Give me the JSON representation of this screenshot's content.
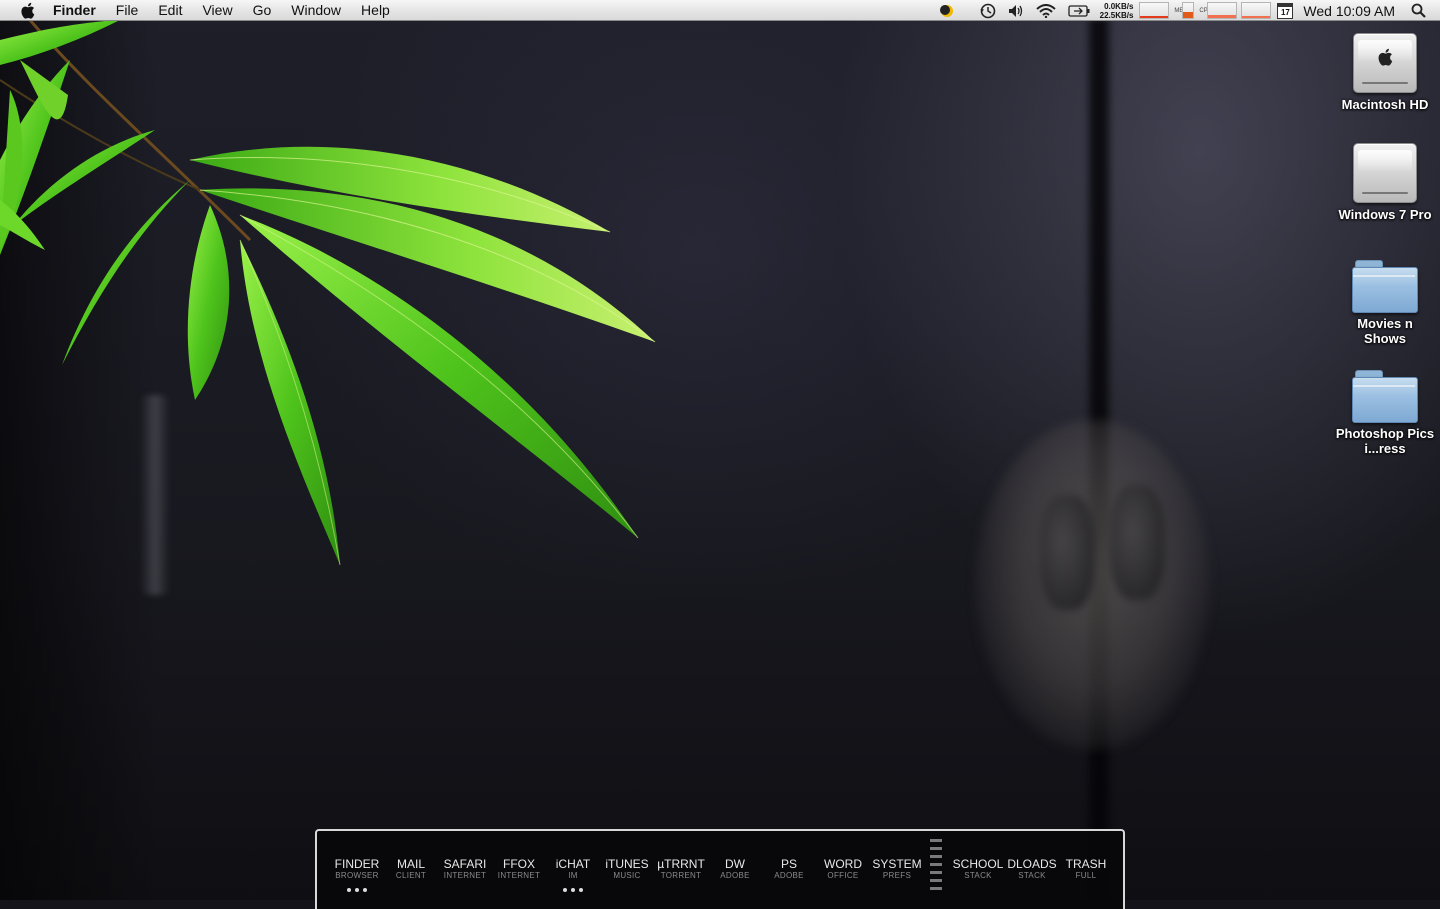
{
  "menubar": {
    "app_name": "Finder",
    "menus": [
      "File",
      "Edit",
      "View",
      "Go",
      "Window",
      "Help"
    ],
    "net_down": "0.0KB/s",
    "net_up": "22.5KB/s",
    "mem_label": "MEM",
    "cpu_label": "CPU",
    "calendar_day": "17",
    "clock": "Wed 10:09 AM",
    "status_icons": [
      "moon-icon",
      "time-machine-icon",
      "volume-icon",
      "wifi-icon",
      "battery-icon",
      "calendar-icon",
      "spotlight-icon"
    ]
  },
  "desktop_icons": [
    {
      "label": "Macintosh HD",
      "kind": "hard-drive-apple"
    },
    {
      "label": "Windows 7 Pro",
      "kind": "hard-drive"
    },
    {
      "label": "Movies n Shows",
      "kind": "folder"
    },
    {
      "label": "Photoshop Pics i...ress",
      "kind": "folder"
    }
  ],
  "dock": {
    "items": [
      {
        "name": "FINDER",
        "sub": "BROWSER",
        "running": true
      },
      {
        "name": "MAIL",
        "sub": "CLIENT",
        "running": false
      },
      {
        "name": "SAFARI",
        "sub": "INTERNET",
        "running": false
      },
      {
        "name": "FFOX",
        "sub": "INTERNET",
        "running": false
      },
      {
        "name": "iCHAT",
        "sub": "IM",
        "running": true
      },
      {
        "name": "iTUNES",
        "sub": "MUSIC",
        "running": false
      },
      {
        "name": "µTRRNT",
        "sub": "TORRENT",
        "running": false
      },
      {
        "name": "DW",
        "sub": "ADOBE",
        "running": false
      },
      {
        "name": "PS",
        "sub": "ADOBE",
        "running": false
      },
      {
        "name": "WORD",
        "sub": "OFFICE",
        "running": false
      },
      {
        "name": "SYSTEM",
        "sub": "PREFS",
        "running": false
      }
    ],
    "stacks": [
      {
        "name": "SCHOOL",
        "sub": "STACK"
      },
      {
        "name": "DLOADS",
        "sub": "STACK"
      },
      {
        "name": "TRASH",
        "sub": "FULL"
      }
    ]
  }
}
